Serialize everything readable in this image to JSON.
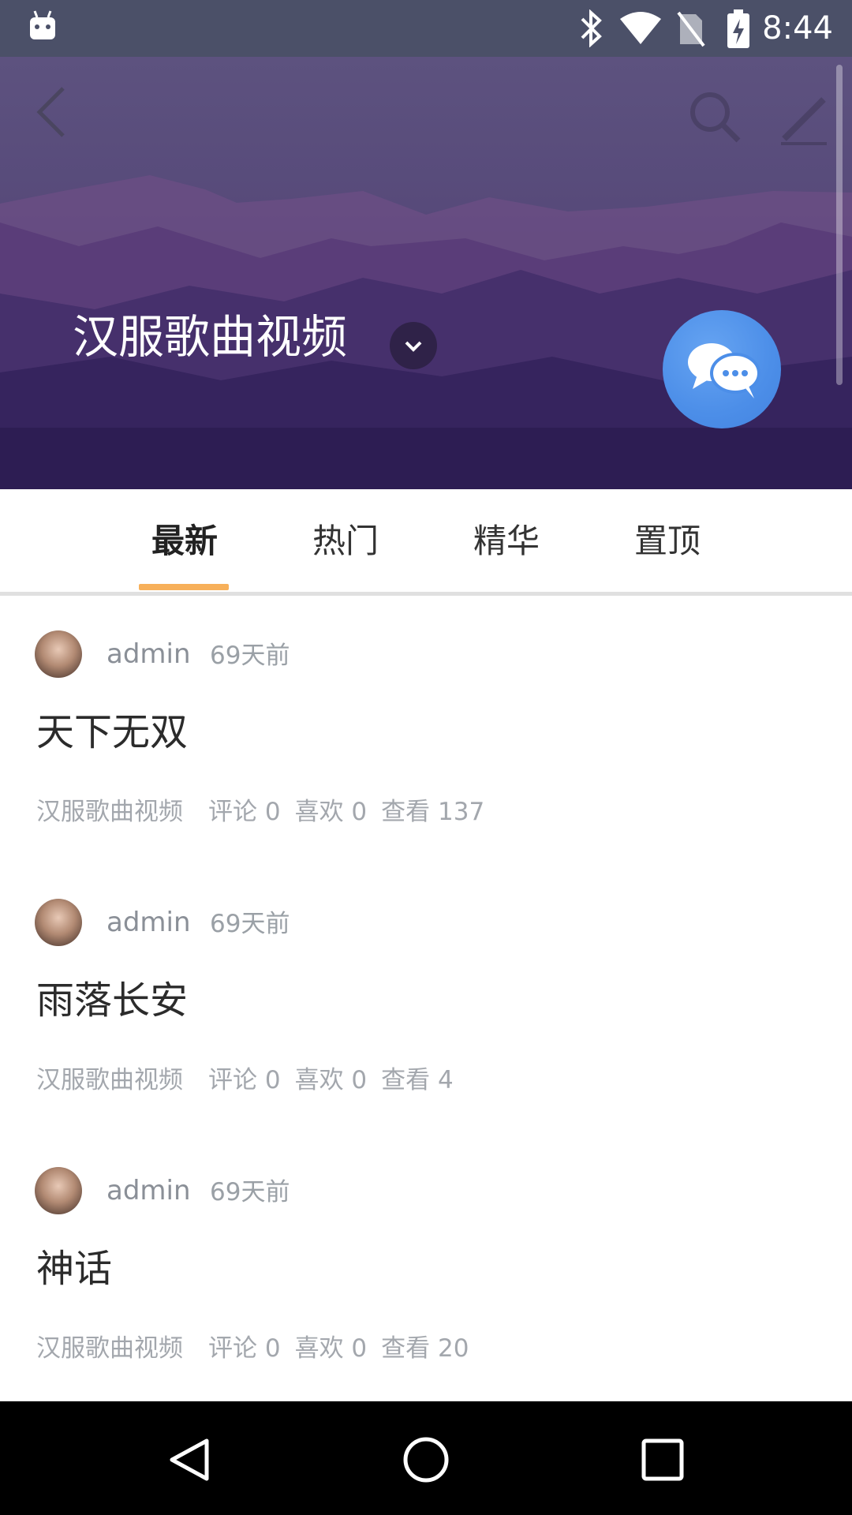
{
  "status_bar": {
    "time": "8:44"
  },
  "header": {
    "title": "汉服歌曲视频",
    "colors": {
      "fab": "#4c8ee8",
      "accent": "#f7b05a"
    }
  },
  "tabs": [
    {
      "label": "最新",
      "active": true
    },
    {
      "label": "热门",
      "active": false
    },
    {
      "label": "精华",
      "active": false
    },
    {
      "label": "置顶",
      "active": false
    }
  ],
  "posts": [
    {
      "author": "admin",
      "time_ago": "69天前",
      "title": "天下无双",
      "category": "汉服歌曲视频",
      "comments_label": "评论 0",
      "likes_label": "喜欢 0",
      "views_label": "查看 137"
    },
    {
      "author": "admin",
      "time_ago": "69天前",
      "title": "雨落长安",
      "category": "汉服歌曲视频",
      "comments_label": "评论 0",
      "likes_label": "喜欢 0",
      "views_label": "查看 4"
    },
    {
      "author": "admin",
      "time_ago": "69天前",
      "title": "神话",
      "category": "汉服歌曲视频",
      "comments_label": "评论 0",
      "likes_label": "喜欢 0",
      "views_label": "查看 20"
    }
  ],
  "icons": [
    "android-icon",
    "bluetooth-icon",
    "wifi-icon",
    "no-sim-icon",
    "battery-icon",
    "back-arrow-icon",
    "search-icon",
    "edit-icon",
    "chevron-down-icon",
    "chat-bubbles-icon",
    "nav-back-icon",
    "nav-home-icon",
    "nav-recents-icon"
  ]
}
